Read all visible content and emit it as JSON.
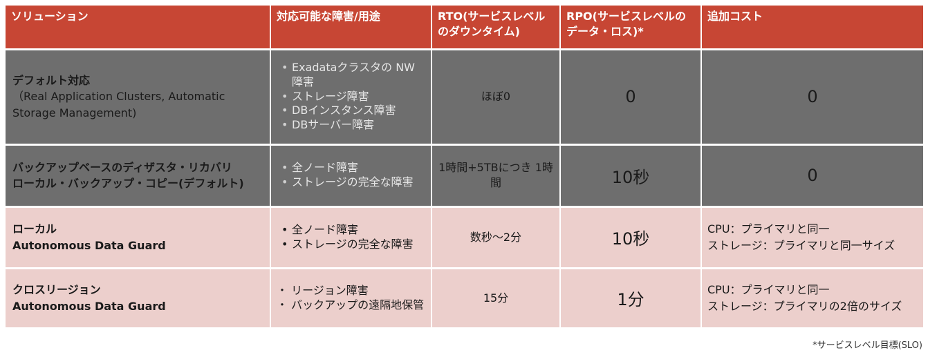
{
  "header": {
    "solution": "ソリューション",
    "use": "対応可能な障害/用途",
    "rto": "RTO(サービスレベルのダウンタイム)",
    "rpo": "RPO(サービスレベルのデータ・ロス)*",
    "cost": "追加コスト"
  },
  "rows": [
    {
      "solution_title": "デフォルト対応",
      "solution_detail": "（Real Application Clusters, Automatic Storage Management)",
      "uses": [
        "Exadataクラスタの NW障害",
        "ストレージ障害",
        "DBインスタンス障害",
        "DBサーバー障害"
      ],
      "rto": "ほぼ0",
      "rpo": "0",
      "cost": "0"
    },
    {
      "solution_title": "バックアップベースのディザスタ・リカバリ",
      "solution_title2": "ローカル・バックアップ・コピー(デフォルト)",
      "uses": [
        "全ノード障害",
        "ストレージの完全な障害"
      ],
      "rto": "1時間+5TBにつき 1時間",
      "rpo": "10秒",
      "cost": "0"
    },
    {
      "solution_title": "ローカル",
      "solution_title2": "Autonomous Data Guard",
      "uses": [
        "全ノード障害",
        "ストレージの完全な障害"
      ],
      "rto": "数秒～2分",
      "rpo": "10秒",
      "cost_line1": "CPU：プライマリと同一",
      "cost_line2": "ストレージ：プライマリと同一サイズ"
    },
    {
      "solution_title": "クロスリージョン",
      "solution_title2": "Autonomous Data Guard",
      "uses": [
        "・ リージョン障害",
        "・ バックアップの遠隔地保管"
      ],
      "rto": "15分",
      "rpo": "1分",
      "cost_line1": "CPU：プライマリと同一",
      "cost_line2": "ストレージ：プライマリの2倍のサイズ"
    }
  ],
  "footnote": "*サービスレベル目標(SLO)",
  "colors": {
    "header": "#c74634",
    "gray_row": "#6e6e6e",
    "pink_row": "#eccfcc"
  }
}
